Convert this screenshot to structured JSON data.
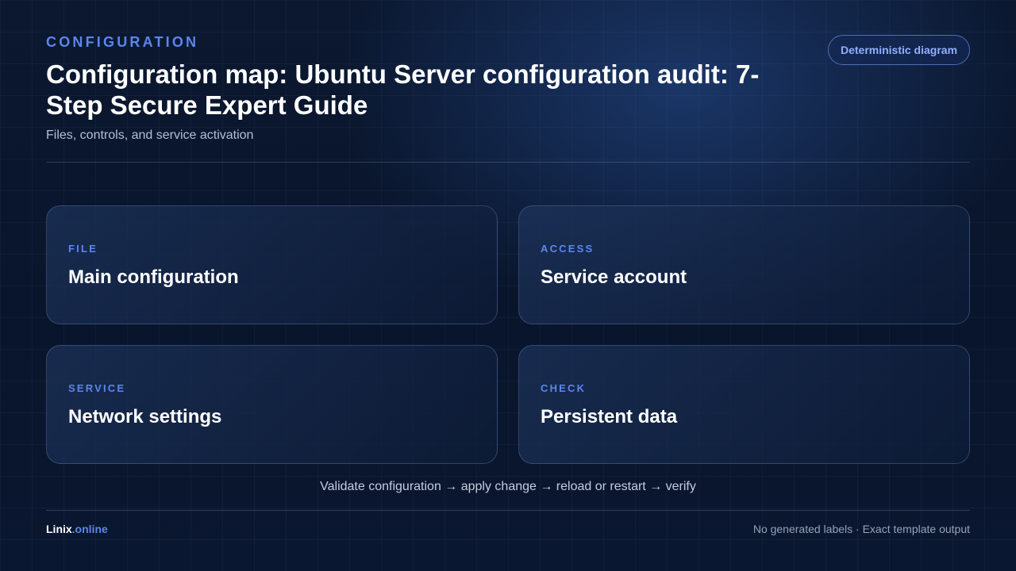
{
  "header": {
    "eyebrow": "CONFIGURATION",
    "title": "Configuration map: Ubuntu Server configuration audit: 7-Step Secure Expert Guide",
    "subtitle": "Files, controls, and service activation",
    "badge": "Deterministic diagram"
  },
  "cards": [
    {
      "kicker": "FILE",
      "heading": "Main configuration"
    },
    {
      "kicker": "ACCESS",
      "heading": "Service account"
    },
    {
      "kicker": "SERVICE",
      "heading": "Network settings"
    },
    {
      "kicker": "CHECK",
      "heading": "Persistent data"
    }
  ],
  "flow": "Validate configuration → apply change → reload or restart → verify",
  "footer": {
    "brand_name": "Linix",
    "brand_suffix": ".online",
    "note": "No generated labels · Exact template output"
  },
  "colors": {
    "accent": "#5b86ee",
    "background": "#0a1730",
    "text": "#ffffff"
  }
}
